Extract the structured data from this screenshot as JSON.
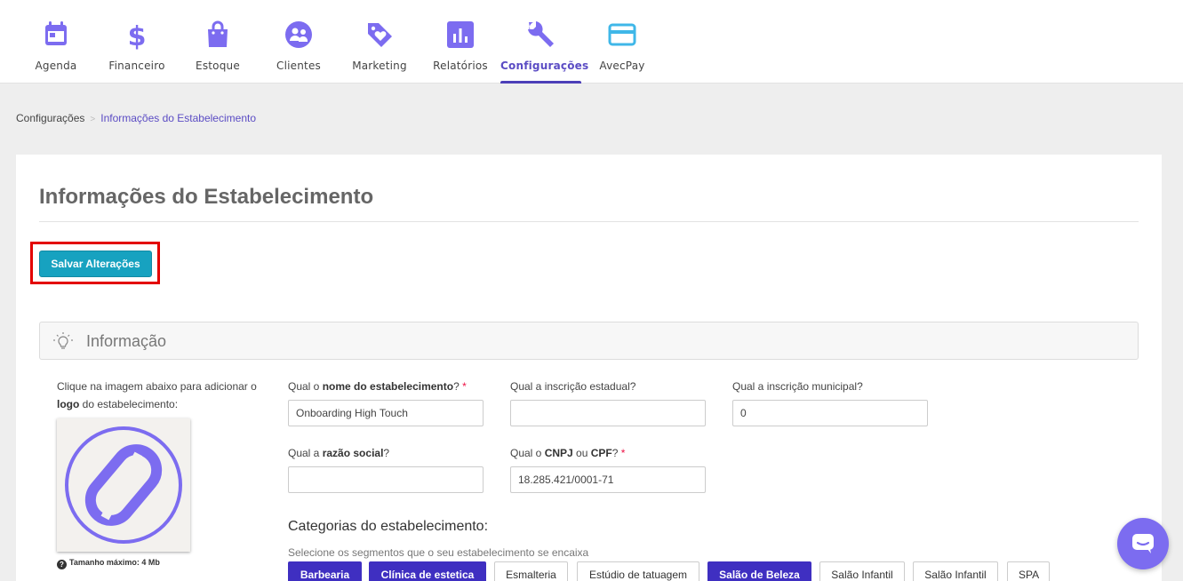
{
  "nav": {
    "items": [
      {
        "label": "Agenda",
        "icon": "calendar-icon"
      },
      {
        "label": "Financeiro",
        "icon": "dollar-icon"
      },
      {
        "label": "Estoque",
        "icon": "shopping-bag-icon"
      },
      {
        "label": "Clientes",
        "icon": "users-icon"
      },
      {
        "label": "Marketing",
        "icon": "tag-heart-icon"
      },
      {
        "label": "Relatórios",
        "icon": "bar-chart-icon"
      },
      {
        "label": "Configurações",
        "icon": "wrench-icon",
        "active": true
      },
      {
        "label": "AvecPay",
        "icon": "credit-card-icon"
      }
    ],
    "icon_color": "#7c6cf0",
    "avecpay_icon_color": "#3fb7e8",
    "active_color": "#5b4cc4"
  },
  "breadcrumb": {
    "root": "Configurações",
    "separator": ">",
    "current": "Informações do Estabelecimento"
  },
  "page": {
    "title": "Informações do Estabelecimento",
    "save_label": "Salvar Alterações",
    "save_color": "#17a2c0"
  },
  "section": {
    "title": "Informação",
    "icon": "lightbulb-icon"
  },
  "logo": {
    "hint_prefix": "Clique na imagem abaixo para adicionar o ",
    "hint_bold": "logo",
    "hint_suffix": " do estabelecimento:",
    "size_note": "Tamanho máximo: 4 Mb"
  },
  "form": {
    "nome": {
      "label_pre": "Qual o ",
      "label_bold": "nome do estabelecimento",
      "label_post": "?",
      "required": "*",
      "value": "Onboarding High Touch"
    },
    "insc_estadual": {
      "label": "Qual a inscrição estadual?",
      "value": ""
    },
    "insc_municipal": {
      "label": "Qual a inscrição municipal?",
      "value": "0"
    },
    "razao": {
      "label_pre": "Qual a ",
      "label_bold": "razão social",
      "label_post": "?",
      "value": ""
    },
    "cnpj": {
      "label_pre": "Qual o ",
      "label_bold": "CNPJ",
      "label_mid": " ou ",
      "label_bold2": "CPF",
      "label_post": "?",
      "required": "*",
      "value": "18.285.421/0001-71"
    }
  },
  "categories": {
    "title": "Categorias do estabelecimento:",
    "subtitle": "Selecione os segmentos que o seu estabelecimento se encaixa",
    "items": [
      {
        "label": "Barbearia",
        "selected": true
      },
      {
        "label": "Clínica de estetica",
        "selected": true
      },
      {
        "label": "Esmalteria",
        "selected": false
      },
      {
        "label": "Estúdio de tatuagem",
        "selected": false
      },
      {
        "label": "Salão de Beleza",
        "selected": true
      },
      {
        "label": "Salão Infantil",
        "selected": false
      },
      {
        "label": "Salão Infantil",
        "selected": false
      },
      {
        "label": "SPA",
        "selected": false
      }
    ]
  },
  "chat": {
    "icon": "chat-bubble-icon",
    "color": "#7c6cf0"
  }
}
